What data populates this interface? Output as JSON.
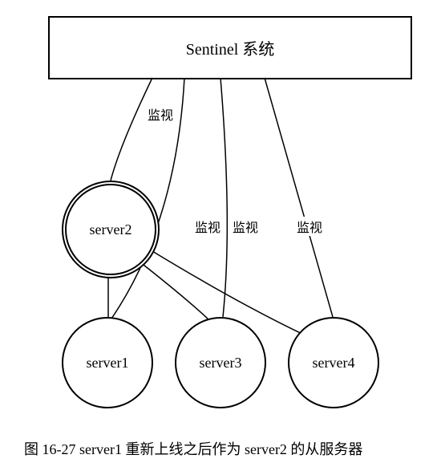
{
  "sentinel": {
    "label": "Sentinel 系统"
  },
  "servers": {
    "server1": "server1",
    "server2": "server2",
    "server3": "server3",
    "server4": "server4"
  },
  "edgeLabels": {
    "toServer2": "监视",
    "toServer1": "监视",
    "toServer3": "监视",
    "toServer4": "监视"
  },
  "caption": "图 16-27    server1 重新上线之后作为 server2 的从服务器"
}
